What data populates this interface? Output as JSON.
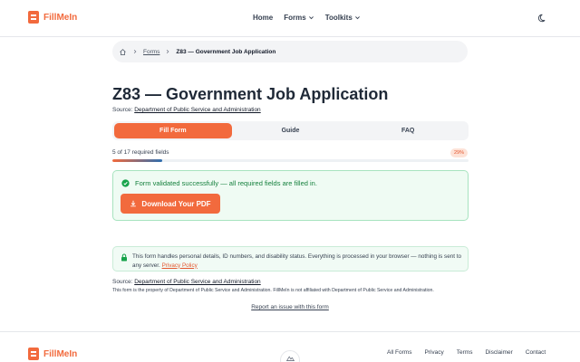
{
  "header": {
    "brand": "FillMeIn",
    "nav": [
      "Home",
      "Forms",
      "Toolkits"
    ],
    "theme_icon": "moon-icon"
  },
  "breadcrumb": {
    "home_icon": "home-icon",
    "link": "Forms",
    "current": "Z83 — Government Job Application"
  },
  "page": {
    "title": "Z83 — Government Job Application",
    "source_label": "Source:",
    "source_name": "Department of Public Service and Administration"
  },
  "tabs": [
    {
      "label": "Fill Form",
      "active": true
    },
    {
      "label": "Guide",
      "active": false
    },
    {
      "label": "FAQ",
      "active": false
    }
  ],
  "progress": {
    "label": "5 of 17 required fields",
    "percent_label": "29%",
    "fraction": 0.14
  },
  "success": {
    "message": "Form validated successfully — all required fields are filled in.",
    "button_label": "Download Your PDF"
  },
  "privacy": {
    "text": "This form handles personal details, ID numbers, and disability status. Everything is processed in your browser — nothing is sent to any server.",
    "link": "Privacy Policy"
  },
  "bottom": {
    "source_label": "Source:",
    "source_name": "Department of Public Service and Administration",
    "disclaimer": "This form is the property of Department of Public Service and Administration. FillMeIn is not affiliated with Department of Public Service and Administration.",
    "report_link": "Report an issue with this form"
  },
  "footer": {
    "brand": "FillMeIn",
    "links": [
      "All Forms",
      "Privacy",
      "Terms",
      "Disclaimer",
      "Contact"
    ]
  },
  "colors": {
    "accent": "#f26a3d",
    "success": "#15803d"
  }
}
